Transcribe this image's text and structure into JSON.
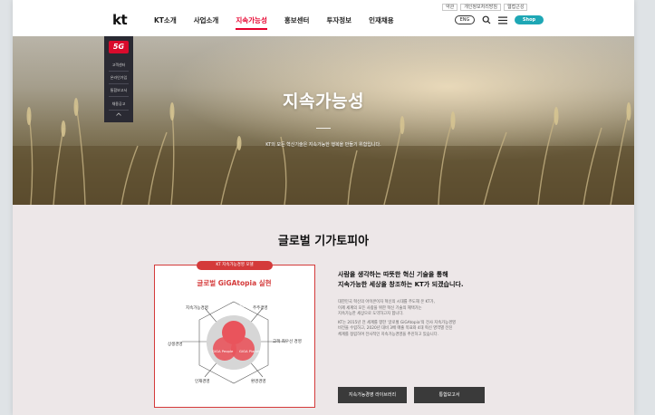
{
  "header": {
    "logo": "kt",
    "nav": [
      "KT소개",
      "사업소개",
      "지속가능성",
      "홍보센터",
      "투자정보",
      "인재채용"
    ],
    "active_nav": "지속가능성",
    "eng_label": "ENG",
    "shop_label": "Shop",
    "utility_links": [
      "약관",
      "개인정보처리방침",
      "웹접근성"
    ],
    "accent_color": "#e6002d",
    "shop_color": "#1ea7b5"
  },
  "quicknav": {
    "badge": "5G",
    "items": [
      "고객센터",
      "온라인가입",
      "통합보고서",
      "채용공고"
    ]
  },
  "hero": {
    "title": "지속가능성",
    "subtitle": "KT의 모든 혁신기술은 지속가능한 행복을 만들기 위함입니다."
  },
  "section": {
    "title": "글로벌 기가토피아"
  },
  "diagram": {
    "tag": "KT 지속가능경영 모델",
    "title": "글로벌 GiGAtopia 실현",
    "core": [
      "GiGA Prosperity",
      "GiGA People",
      "GiGA Planet"
    ],
    "labels": [
      "지속가능경영",
      "주주경영",
      "상생경영",
      "고객 최우선 경영",
      "인재경영",
      "환경경영"
    ]
  },
  "description": {
    "headline_1": "사람을 생각하는 따뜻한 혁신 기술을 통해",
    "headline_2": "지속가능한 세상을 창조하는 KT가 되겠습니다.",
    "body_1": "대한민국 혁신의 아이콘이자 혁신의 시대를 주도해 온 KT가,",
    "body_2": "이제 세계의 모든 사람을 위한 혁신 기술의 혜택가는",
    "body_3": "지속가능한 세상으로 도약하고자 합니다.",
    "body_4": "KT는 2015년 전 세계를 향한 '글로벌 GiGAtopia'의 전사 지속가능경영",
    "body_5": "비전을 수립하고, 2020년 대비 3배 매출 목표와 4대 혁신 영역별 전진",
    "body_6": "체계를 정립하여 전사적인 지속가능경영을 추진하고 있습니다."
  },
  "buttons": {
    "report_library": "지속가능경영 라이브러리",
    "integrated_report": "통합보고서"
  }
}
